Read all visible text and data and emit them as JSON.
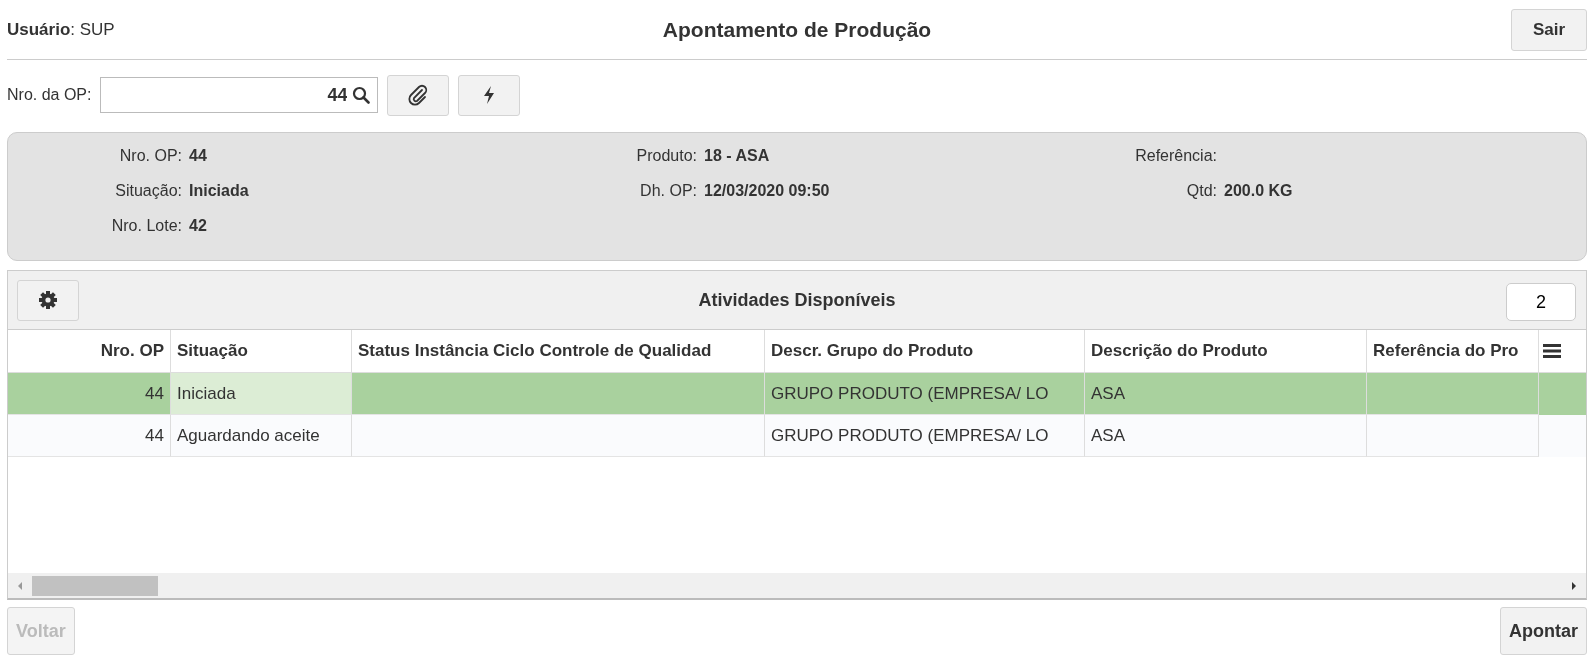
{
  "header": {
    "user": "**Usuário**: SUP",
    "title": "Apontamento de Produção",
    "exit_button": "Sair"
  },
  "search": {
    "label": "Nro. da OP:",
    "value": "44"
  },
  "info": {
    "columns": [
      [
        {
          "label": "Nro. OP:",
          "value": "44"
        },
        {
          "label": "Situação:",
          "value": "Iniciada"
        },
        {
          "label": "Nro. Lote:",
          "value": "42"
        }
      ],
      [
        {
          "label": "Produto:",
          "value": "18 - ASA"
        },
        {
          "label": "Dh. OP:",
          "value": "12/03/2020 09:50"
        }
      ],
      [
        {
          "label": "Referência:"
        },
        {
          "label": "Qtd:",
          "value": "200.0 KG"
        }
      ]
    ]
  },
  "grid": {
    "title": "Atividades Disponíveis",
    "count_badge": "2",
    "columns": [
      {
        "label": "Nro. OP",
        "numeric": true
      },
      {
        "label": "Situação",
        "numeric": false
      },
      {
        "label": "Status Instância Ciclo Controle de Qualidad",
        "numeric": false
      },
      {
        "label": "Descr. Grupo do Produto",
        "numeric": false
      },
      {
        "label": "Descrição do Produto",
        "numeric": false
      },
      {
        "label": "Referência do Pro",
        "numeric": false
      }
    ],
    "rows": [
      {
        "selected": true,
        "cells": [
          {
            "text": "44",
            "focused": false
          },
          {
            "text": "Iniciada",
            "focused": true
          },
          {
            "focused": false
          },
          {
            "text": "GRUPO PRODUTO (EMPRESA/ LO",
            "focused": false
          },
          {
            "text": "ASA",
            "focused": false
          },
          {
            "focused": false
          }
        ]
      },
      {
        "selected": false,
        "cells": [
          {
            "text": "44",
            "focused": false
          },
          {
            "text": "Aguardando aceite",
            "focused": false
          },
          {
            "focused": false
          },
          {
            "text": "GRUPO PRODUTO (EMPRESA/ LO",
            "focused": false
          },
          {
            "text": "ASA",
            "focused": false
          },
          {
            "focused": false
          }
        ]
      }
    ]
  },
  "footer": {
    "back_button": {
      "label": "Voltar",
      "disabled": true
    },
    "submit_button": {
      "label": "Apontar",
      "disabled": false
    }
  }
}
